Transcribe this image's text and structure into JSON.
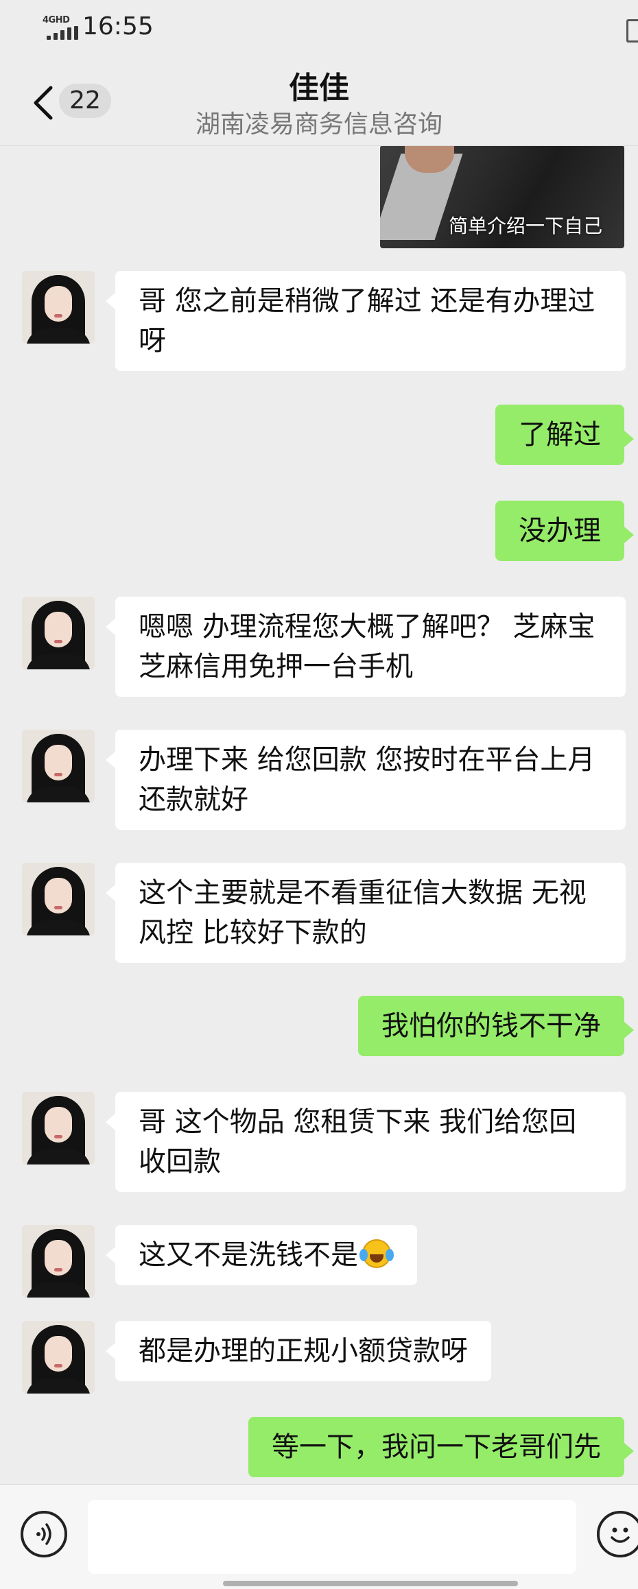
{
  "status_bar": {
    "network": "4GHD",
    "time": "16:55"
  },
  "header": {
    "unread_count": "22",
    "title": "佳佳",
    "subtitle": "湖南凌易商务信息咨询"
  },
  "photo": {
    "caption": "简单介绍一下自己"
  },
  "messages": [
    {
      "side": "in",
      "text": "哥 您之前是稍微了解过 还是有办理过呀"
    },
    {
      "side": "out",
      "text": "了解过"
    },
    {
      "side": "out",
      "text": "没办理"
    },
    {
      "side": "in",
      "text": "嗯嗯 办理流程您大概了解吧？ 芝麻宝芝麻信用免押一台手机"
    },
    {
      "side": "in",
      "text": "办理下来 给您回款 您按时在平台上月还款就好"
    },
    {
      "side": "in",
      "text": "这个主要就是不看重征信大数据 无视风控 比较好下款的"
    },
    {
      "side": "out",
      "text": "我怕你的钱不干净"
    },
    {
      "side": "in",
      "text": "哥 这个物品 您租赁下来 我们给您回收回款"
    },
    {
      "side": "in",
      "text": "这又不是洗钱不是",
      "emoji": "face-with-tears-of-joy"
    },
    {
      "side": "in",
      "text": "都是办理的正规小额贷款呀"
    },
    {
      "side": "out",
      "text": "等一下，我问一下老哥们先"
    }
  ],
  "colors": {
    "background": "#ededed",
    "incoming_bubble": "#ffffff",
    "outgoing_bubble": "#95ec69"
  },
  "input_bar": {
    "value": "",
    "icons": [
      "voice-icon",
      "emoji-icon"
    ]
  }
}
